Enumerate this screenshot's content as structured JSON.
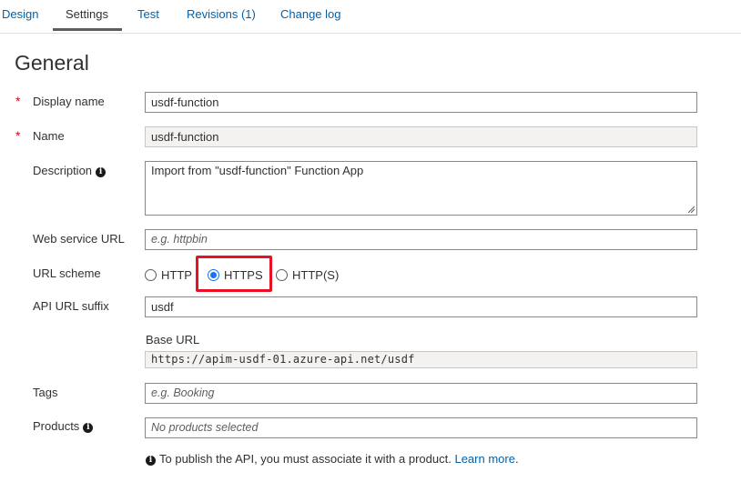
{
  "tabs": [
    {
      "label": "Design",
      "active": false
    },
    {
      "label": "Settings",
      "active": true
    },
    {
      "label": "Test",
      "active": false
    },
    {
      "label": "Revisions (1)",
      "active": false
    },
    {
      "label": "Change log",
      "active": false
    }
  ],
  "section_title": "General",
  "form": {
    "display_name": {
      "label": "Display name",
      "required_mark": "*",
      "value": "usdf-function"
    },
    "name": {
      "label": "Name",
      "required_mark": "*",
      "value": "usdf-function"
    },
    "description": {
      "label": "Description",
      "value": "Import from \"usdf-function\" Function App"
    },
    "web_service_url": {
      "label": "Web service URL",
      "placeholder": "e.g. httpbin"
    },
    "url_scheme": {
      "label": "URL scheme",
      "options": [
        {
          "label": "HTTP",
          "selected": false
        },
        {
          "label": "HTTPS",
          "selected": true
        },
        {
          "label": "HTTP(S)",
          "selected": false
        }
      ]
    },
    "api_url_suffix": {
      "label": "API URL suffix",
      "value": "usdf"
    },
    "base_url": {
      "label": "Base URL",
      "value": "https://apim-usdf-01.azure-api.net/usdf"
    },
    "tags": {
      "label": "Tags",
      "placeholder": "e.g. Booking"
    },
    "products": {
      "label": "Products",
      "placeholder": "No products selected"
    }
  },
  "note": {
    "text": "To publish the API, you must associate it with a product.",
    "link_label": "Learn more",
    "trailing": "."
  },
  "icons": {
    "info": "info-icon",
    "radio_selected": "radio-selected-icon"
  },
  "colors": {
    "link": "#0062ad",
    "required": "#c50f1f",
    "highlight": "#e81123",
    "radio_accent": "#1a73e8"
  }
}
